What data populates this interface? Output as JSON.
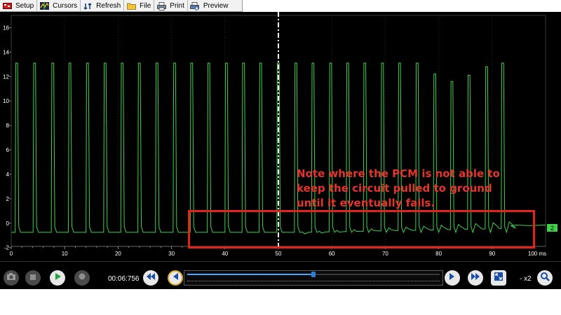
{
  "toolbar": {
    "items": [
      {
        "label": "Setup",
        "icon": "setup-icon"
      },
      {
        "label": "Cursors",
        "icon": "cursors-icon"
      },
      {
        "label": "Refresh",
        "icon": "refresh-icon"
      },
      {
        "label": "File",
        "icon": "folder-icon"
      },
      {
        "label": "Print",
        "icon": "print-icon"
      },
      {
        "label": "Preview",
        "icon": "print-preview-icon"
      }
    ]
  },
  "scope": {
    "y_ticks": [
      "16",
      "14",
      "12",
      "10",
      "8",
      "6",
      "4",
      "2",
      "0",
      "-2"
    ],
    "x_ticks": [
      "0",
      "10",
      "20",
      "30",
      "40",
      "50",
      "60",
      "70",
      "80",
      "90",
      "100 ms"
    ],
    "channel_marker": "2",
    "trace_color": "#3fd14a",
    "cursor_at_ms": 50
  },
  "note": {
    "lines": [
      "Note where the PCM is not able to",
      "keep the circuit pulled to ground",
      "until it eventually fails."
    ],
    "color": "#e5352b"
  },
  "playback": {
    "time": "00:06:756",
    "zoom": "- x2",
    "position_fraction": 0.5
  }
}
